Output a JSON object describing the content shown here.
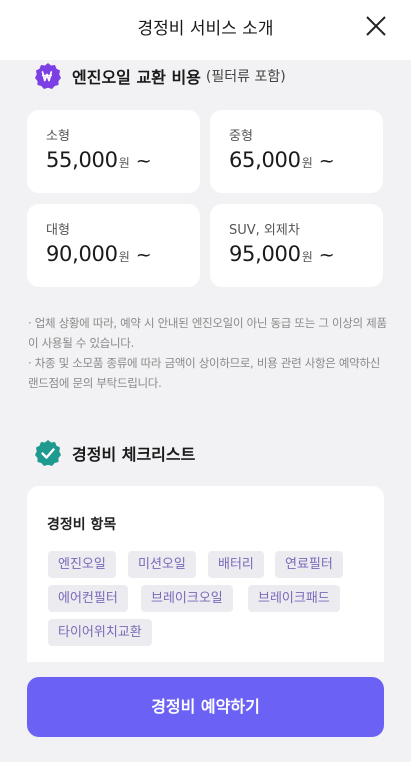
{
  "header": {
    "title": "경정비 서비스 소개"
  },
  "oil_section": {
    "title": "엔진오일 교환 비용",
    "subtitle": "(필터류 포함)",
    "badge_icon": "won-icon",
    "badge_color": "#7b3fe4",
    "prices": [
      {
        "label": "소형",
        "amount": "55,000",
        "unit": "원",
        "suffix": "~"
      },
      {
        "label": "중형",
        "amount": "65,000",
        "unit": "원",
        "suffix": "~"
      },
      {
        "label": "대형",
        "amount": "90,000",
        "unit": "원",
        "suffix": "~"
      },
      {
        "label": "SUV, 외제차",
        "amount": "95,000",
        "unit": "원",
        "suffix": "~"
      }
    ],
    "notices": [
      "· 업체 상황에 따라, 예약 시 안내된 엔진오일이 아닌 동급 또는 그 이상의 제품이 사용될 수 있습니다.",
      "· 차종 및 소모품 종류에 따라 금액이 상이하므로, 비용 관련 사항은 예약하신 랜드점에 문의 부탁드립니다."
    ]
  },
  "checklist_section": {
    "title": "경정비 체크리스트",
    "badge_icon": "check-badge-icon",
    "badge_color": "#1e9a8e",
    "card_title": "경정비 항목",
    "items": [
      "엔진오일",
      "미션오일",
      "배터리",
      "연료필터",
      "에어컨필터",
      "브레이크오일",
      "브레이크패드",
      "타이어위치교환"
    ]
  },
  "cta": {
    "label": "경정비 예약하기",
    "color": "#6b62f5"
  }
}
